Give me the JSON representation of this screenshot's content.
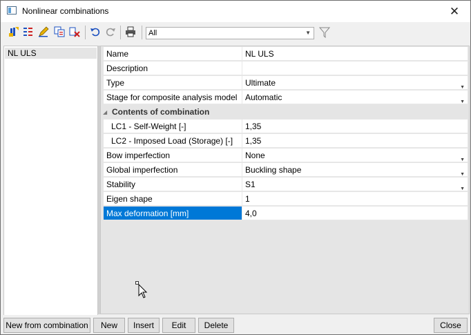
{
  "window": {
    "title": "Nonlinear combinations",
    "close_glyph": "✕"
  },
  "toolbar": {
    "icons": [
      "add-combination-icon",
      "edit-entries-icon",
      "edit-pencil-icon",
      "copy-icon",
      "delete-icon",
      "undo-icon",
      "redo-icon",
      "print-icon",
      "filter-icon"
    ],
    "filter_value": "All"
  },
  "list": {
    "items": [
      {
        "label": "NL ULS"
      }
    ]
  },
  "properties": {
    "name": {
      "label": "Name",
      "value": "NL ULS"
    },
    "description": {
      "label": "Description",
      "value": ""
    },
    "type": {
      "label": "Type",
      "value": "Ultimate"
    },
    "stage": {
      "label": "Stage for composite analysis model",
      "value": "Automatic"
    },
    "contents_section": {
      "label": "Contents of combination"
    },
    "lc1": {
      "label": "LC1 - Self-Weight [-]",
      "value": "1,35"
    },
    "lc2": {
      "label": "LC2 - Imposed Load (Storage) [-]",
      "value": "1,35"
    },
    "bow": {
      "label": "Bow imperfection",
      "value": "None"
    },
    "global": {
      "label": "Global imperfection",
      "value": "Buckling shape"
    },
    "stability": {
      "label": "Stability",
      "value": "S1"
    },
    "eigen": {
      "label": "Eigen shape",
      "value": "1"
    },
    "max_def": {
      "label": "Max deformation [mm]",
      "value": "4,0"
    }
  },
  "buttons": {
    "new_from_combination": "New from combination",
    "new": "New",
    "insert": "Insert",
    "edit": "Edit",
    "delete": "Delete",
    "close": "Close"
  },
  "colors": {
    "selection": "#0078d7",
    "grid_background": "#e5e5e5",
    "window_background": "#f0f0f0"
  }
}
